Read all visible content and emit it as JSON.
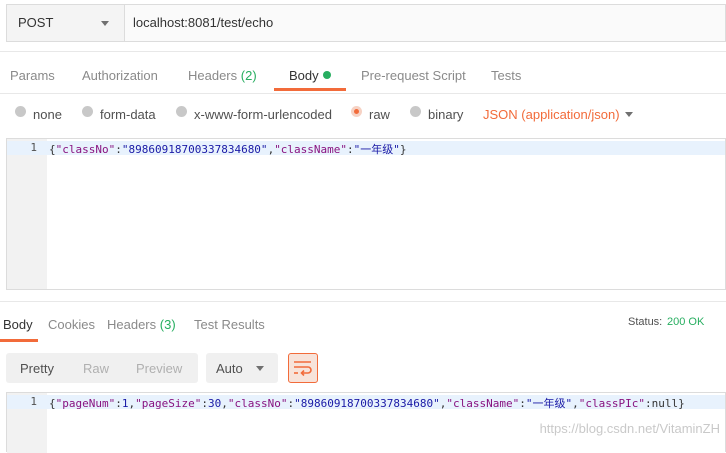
{
  "request": {
    "method": "POST",
    "url": "localhost:8081/test/echo"
  },
  "request_tabs": {
    "params": "Params",
    "authorization": "Authorization",
    "headers": "Headers",
    "headers_count": "(2)",
    "body": "Body",
    "prerequest": "Pre-request Script",
    "tests": "Tests"
  },
  "body_options": {
    "none": "none",
    "form_data": "form-data",
    "urlencoded": "x-www-form-urlencoded",
    "raw": "raw",
    "binary": "binary",
    "content_type": "JSON (application/json)",
    "selected": "raw"
  },
  "request_editor": {
    "line_number": "1",
    "tokens": [
      "{",
      "\"classNo\"",
      ":",
      "\"89860918700337834680\"",
      ",",
      "\"className\"",
      ":",
      "\"一年级\"",
      "}"
    ]
  },
  "response_tabs": {
    "body": "Body",
    "cookies": "Cookies",
    "headers": "Headers",
    "headers_count": "(3)",
    "test_results": "Test Results"
  },
  "status": {
    "label": "Status:",
    "value": "200 OK"
  },
  "response_view": {
    "pretty": "Pretty",
    "raw": "Raw",
    "preview": "Preview",
    "format": "Auto"
  },
  "response_editor": {
    "line_number": "1",
    "tokens": [
      "{",
      "\"pageNum\"",
      ":",
      "1",
      ",",
      "\"pageSize\"",
      ":",
      "30",
      ",",
      "\"classNo\"",
      ":",
      "\"89860918700337834680\"",
      ",",
      "\"className\"",
      ":",
      "\"一年级\"",
      ",",
      "\"classPIc\"",
      ":",
      "null",
      "}"
    ]
  },
  "watermark": "https://blog.csdn.net/VitaminZH",
  "colors": {
    "accent": "#f26b3a",
    "success": "#27ae60"
  }
}
